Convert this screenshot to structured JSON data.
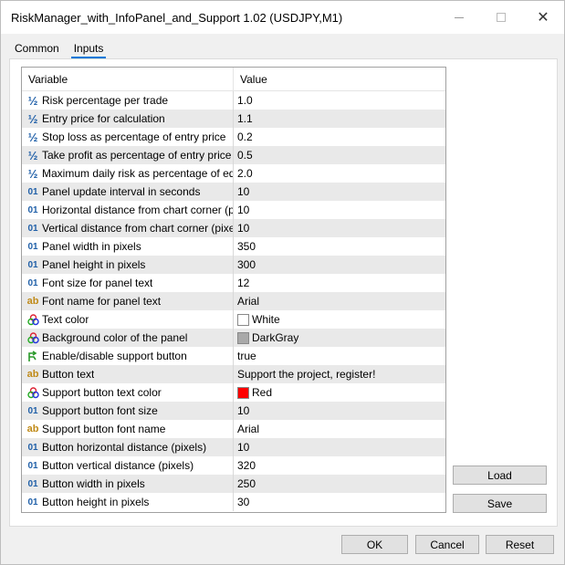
{
  "window": {
    "title": "RiskManager_with_InfoPanel_and_Support 1.02 (USDJPY,M1)",
    "minimize_label": "—",
    "close_label": "✕"
  },
  "tabs": [
    {
      "label": "Common",
      "active": false
    },
    {
      "label": "Inputs",
      "active": true
    }
  ],
  "table": {
    "headers": {
      "variable": "Variable",
      "value": "Value"
    },
    "rows": [
      {
        "icon": "double-icon",
        "glyph": "½",
        "label": "Risk percentage per trade",
        "value": "1.0"
      },
      {
        "icon": "double-icon",
        "glyph": "½",
        "label": "Entry price for calculation",
        "value": "1.1"
      },
      {
        "icon": "double-icon",
        "glyph": "½",
        "label": "Stop loss as percentage of entry price",
        "value": "0.2"
      },
      {
        "icon": "double-icon",
        "glyph": "½",
        "label": "Take profit as percentage of entry price",
        "value": "0.5"
      },
      {
        "icon": "double-icon",
        "glyph": "½",
        "label": "Maximum daily risk as percentage of eq...",
        "value": "2.0"
      },
      {
        "icon": "integer-icon",
        "glyph": "01",
        "label": "Panel update interval in seconds",
        "value": "10"
      },
      {
        "icon": "integer-icon",
        "glyph": "01",
        "label": "Horizontal distance from chart corner (pi...",
        "value": "10"
      },
      {
        "icon": "integer-icon",
        "glyph": "01",
        "label": "Vertical distance from chart corner (pixels)",
        "value": "10"
      },
      {
        "icon": "integer-icon",
        "glyph": "01",
        "label": "Panel width in pixels",
        "value": "350"
      },
      {
        "icon": "integer-icon",
        "glyph": "01",
        "label": "Panel height in pixels",
        "value": "300"
      },
      {
        "icon": "integer-icon",
        "glyph": "01",
        "label": "Font size for panel text",
        "value": "12"
      },
      {
        "icon": "string-icon",
        "glyph": "ab",
        "label": "Font name for panel text",
        "value": "Arial"
      },
      {
        "icon": "color-icon",
        "glyph": "",
        "label": "Text color",
        "value": "White",
        "swatch": "#ffffff"
      },
      {
        "icon": "color-icon",
        "glyph": "",
        "label": "Background color of the panel",
        "value": "DarkGray",
        "swatch": "#a9a9a9"
      },
      {
        "icon": "bool-icon",
        "glyph": "",
        "label": "Enable/disable support button",
        "value": "true"
      },
      {
        "icon": "string-icon",
        "glyph": "ab",
        "label": "Button text",
        "value": "Support the project, register!"
      },
      {
        "icon": "color-icon",
        "glyph": "",
        "label": "Support button text color",
        "value": "Red",
        "swatch": "#ff0000"
      },
      {
        "icon": "integer-icon",
        "glyph": "01",
        "label": "Support button font size",
        "value": "10"
      },
      {
        "icon": "string-icon",
        "glyph": "ab",
        "label": "Support button font name",
        "value": "Arial"
      },
      {
        "icon": "integer-icon",
        "glyph": "01",
        "label": "Button horizontal distance (pixels)",
        "value": "10"
      },
      {
        "icon": "integer-icon",
        "glyph": "01",
        "label": "Button vertical distance (pixels)",
        "value": "320"
      },
      {
        "icon": "integer-icon",
        "glyph": "01",
        "label": "Button width in pixels",
        "value": "250"
      },
      {
        "icon": "integer-icon",
        "glyph": "01",
        "label": "Button height in pixels",
        "value": "30"
      }
    ]
  },
  "buttons": {
    "load": "Load",
    "save": "Save",
    "ok": "OK",
    "cancel": "Cancel",
    "reset": "Reset"
  },
  "colors": {
    "accent": "#0078d7",
    "row_alt": "#e9e9e9",
    "double_icon": "#1f5fa8",
    "string_icon": "#c08a18"
  }
}
